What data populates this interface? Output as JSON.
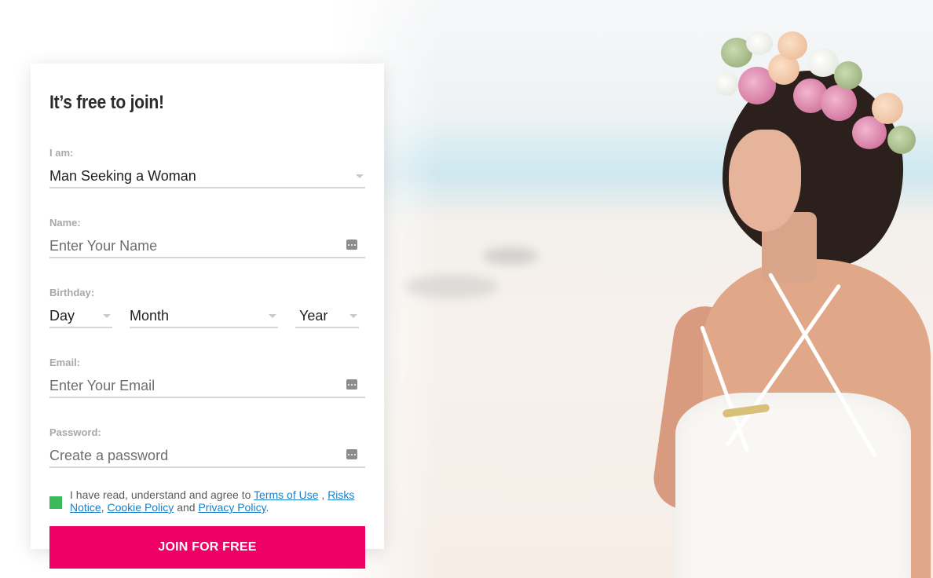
{
  "hero": {
    "image": "woman-with-flower-crown-on-beach"
  },
  "form": {
    "title": "It’s free to join!",
    "iam": {
      "label": "I am:",
      "value": "Man Seeking a Woman"
    },
    "name": {
      "label": "Name:",
      "placeholder": "Enter Your Name"
    },
    "birthday": {
      "label": "Birthday:",
      "day": "Day",
      "month": "Month",
      "year": "Year"
    },
    "email": {
      "label": "Email:",
      "placeholder": "Enter Your Email"
    },
    "password": {
      "label": "Password:",
      "placeholder": "Create a password"
    },
    "agree": {
      "prefix": "I have read, understand and agree to",
      "terms": "Terms of Use",
      "sep1": ",",
      "risks": "Risks Notice",
      "sep2": ",",
      "cookie": "Cookie Policy",
      "and": "and",
      "privacy": "Privacy Policy",
      "end": ".",
      "checked": true
    },
    "submit_label": "JOIN FOR FREE"
  },
  "colors": {
    "accent": "#ee0066",
    "checkbox": "#3cb95b",
    "link": "#1a80c9"
  },
  "icons": [
    "caret-down-icon",
    "dots-icon"
  ]
}
